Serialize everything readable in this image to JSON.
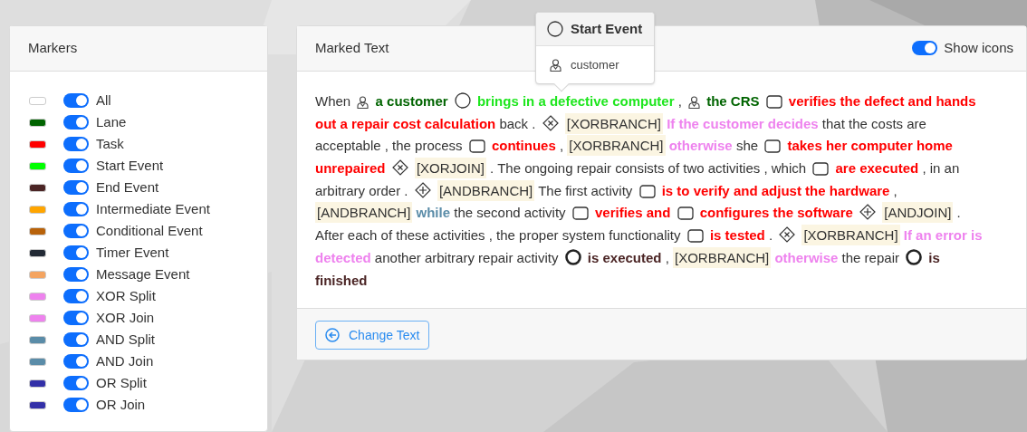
{
  "markers_panel": {
    "title": "Markers",
    "markers": [
      {
        "label": "All",
        "color": "#ffffff",
        "on": true
      },
      {
        "label": "Lane",
        "color": "#006400",
        "on": true
      },
      {
        "label": "Task",
        "color": "#ff0000",
        "on": true
      },
      {
        "label": "Start Event",
        "color": "#00ff00",
        "on": true
      },
      {
        "label": "End Event",
        "color": "#4b2525",
        "on": true
      },
      {
        "label": "Intermediate Event",
        "color": "#ffa500",
        "on": true
      },
      {
        "label": "Conditional Event",
        "color": "#b8620a",
        "on": true
      },
      {
        "label": "Timer Event",
        "color": "#222a35",
        "on": true
      },
      {
        "label": "Message Event",
        "color": "#f4a460",
        "on": true
      },
      {
        "label": "XOR Split",
        "color": "#ee82ee",
        "on": true
      },
      {
        "label": "XOR Join",
        "color": "#ee82ee",
        "on": true
      },
      {
        "label": "AND Split",
        "color": "#5a8ca8",
        "on": true
      },
      {
        "label": "AND Join",
        "color": "#5a8ca8",
        "on": true
      },
      {
        "label": "OR Split",
        "color": "#3330a8",
        "on": true
      },
      {
        "label": "OR Join",
        "color": "#3330a8",
        "on": true
      }
    ]
  },
  "marked_text_panel": {
    "title": "Marked Text",
    "show_icons": {
      "label": "Show icons",
      "on": true
    },
    "lines": [
      {
        "segments": [
          {
            "kind": "text",
            "text": "When"
          },
          {
            "kind": "lane"
          },
          {
            "kind": "mark",
            "text": "a customer",
            "color": "#006400"
          },
          {
            "kind": "start"
          },
          {
            "kind": "mark",
            "text": "brings in a defective computer",
            "color": "#1ee61e"
          },
          {
            "kind": "text",
            "text": ","
          },
          {
            "kind": "lane"
          },
          {
            "kind": "mark",
            "text": "the CRS",
            "color": "#006400"
          },
          {
            "kind": "task"
          },
          {
            "kind": "mark",
            "text": "verifies the defect and hands",
            "color": "#ff0000"
          }
        ]
      },
      {
        "segments": [
          {
            "kind": "mark",
            "text": "out a repair cost calculation",
            "color": "#ff0000"
          },
          {
            "kind": "text",
            "text": "back ."
          },
          {
            "kind": "xor"
          },
          {
            "kind": "tag",
            "text": "[XORBRANCH]"
          },
          {
            "kind": "mark",
            "text": "If the customer decides",
            "color": "#ee82ee"
          },
          {
            "kind": "text",
            "text": "that the costs are"
          }
        ]
      },
      {
        "segments": [
          {
            "kind": "text",
            "text": "acceptable , the process"
          },
          {
            "kind": "task"
          },
          {
            "kind": "mark",
            "text": "continues",
            "color": "#ff0000"
          },
          {
            "kind": "text",
            "text": ","
          },
          {
            "kind": "tag",
            "text": "[XORBRANCH]"
          },
          {
            "kind": "mark",
            "text": "otherwise",
            "color": "#ee82ee"
          },
          {
            "kind": "text",
            "text": "she"
          },
          {
            "kind": "task"
          },
          {
            "kind": "mark",
            "text": "takes her computer home",
            "color": "#ff0000"
          }
        ]
      },
      {
        "segments": [
          {
            "kind": "mark",
            "text": "unrepaired",
            "color": "#ff0000"
          },
          {
            "kind": "xor"
          },
          {
            "kind": "tag",
            "text": "[XORJOIN]"
          },
          {
            "kind": "text",
            "text": ". The ongoing repair consists of two activities , which"
          },
          {
            "kind": "task"
          },
          {
            "kind": "mark",
            "text": "are executed",
            "color": "#ff0000"
          },
          {
            "kind": "text",
            "text": ", in an"
          }
        ]
      },
      {
        "segments": [
          {
            "kind": "text",
            "text": "arbitrary order ."
          },
          {
            "kind": "and"
          },
          {
            "kind": "tag",
            "text": "[ANDBRANCH]"
          },
          {
            "kind": "text",
            "text": "The first activity"
          },
          {
            "kind": "task"
          },
          {
            "kind": "mark",
            "text": "is to verify and adjust the hardware",
            "color": "#ff0000"
          },
          {
            "kind": "text",
            "text": ","
          }
        ]
      },
      {
        "segments": [
          {
            "kind": "tag",
            "text": "[ANDBRANCH]"
          },
          {
            "kind": "mark",
            "text": "while",
            "color": "#5a8ca8"
          },
          {
            "kind": "text",
            "text": "the second activity"
          },
          {
            "kind": "task"
          },
          {
            "kind": "mark",
            "text": "verifies and",
            "color": "#ff0000"
          },
          {
            "kind": "task"
          },
          {
            "kind": "mark",
            "text": "configures the software",
            "color": "#ff0000"
          },
          {
            "kind": "and"
          },
          {
            "kind": "tag",
            "text": "[ANDJOIN]"
          },
          {
            "kind": "text",
            "text": "."
          }
        ]
      },
      {
        "segments": [
          {
            "kind": "text",
            "text": "After each of these activities , the proper system functionality"
          },
          {
            "kind": "task"
          },
          {
            "kind": "mark",
            "text": "is tested",
            "color": "#ff0000"
          },
          {
            "kind": "text",
            "text": "."
          },
          {
            "kind": "xor"
          },
          {
            "kind": "tag",
            "text": "[XORBRANCH]"
          },
          {
            "kind": "mark",
            "text": "If an error is",
            "color": "#ee82ee"
          }
        ]
      },
      {
        "segments": [
          {
            "kind": "mark",
            "text": "detected",
            "color": "#ee82ee"
          },
          {
            "kind": "text",
            "text": "another arbitrary repair activity"
          },
          {
            "kind": "end"
          },
          {
            "kind": "mark",
            "text": "is executed",
            "color": "#4b2525"
          },
          {
            "kind": "text",
            "text": ","
          },
          {
            "kind": "tag",
            "text": "[XORBRANCH]"
          },
          {
            "kind": "mark",
            "text": "otherwise",
            "color": "#ee82ee"
          },
          {
            "kind": "text",
            "text": "the repair"
          },
          {
            "kind": "end"
          },
          {
            "kind": "mark",
            "text": "is",
            "color": "#4b2525"
          }
        ]
      },
      {
        "segments": [
          {
            "kind": "mark",
            "text": "finished",
            "color": "#4b2525"
          }
        ]
      }
    ],
    "button": "Change Text"
  },
  "tooltip": {
    "title": "Start Event",
    "lane": "customer"
  }
}
